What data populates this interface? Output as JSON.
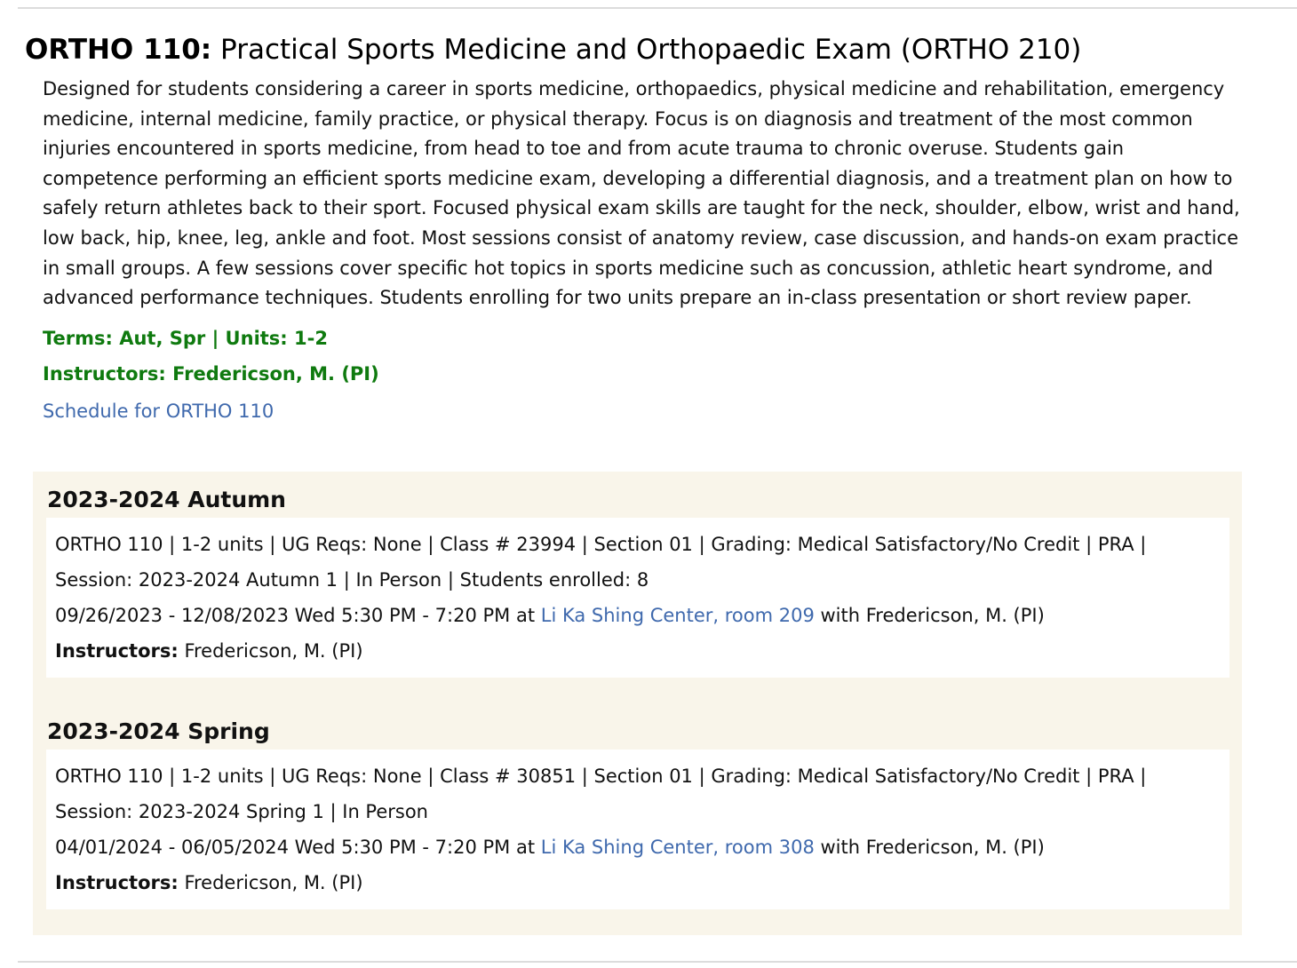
{
  "course": {
    "code": "ORTHO 110:",
    "title": "Practical Sports Medicine and Orthopaedic Exam (ORTHO 210)",
    "description": "Designed for students considering a career in sports medicine, orthopaedics, physical medicine and rehabilitation, emergency medicine, internal medicine, family practice, or physical therapy. Focus is on diagnosis and treatment of the most common injuries encountered in sports medicine, from head to toe and from acute trauma to chronic overuse. Students gain competence performing an efficient sports medicine exam, developing a differential diagnosis, and a treatment plan on how to safely return athletes back to their sport. Focused physical exam skills are taught for the neck, shoulder, elbow, wrist and hand, low back, hip, knee, leg, ankle and foot. Most sessions consist of anatomy review, case discussion, and hands-on exam practice in small groups. A few sessions cover specific hot topics in sports medicine such as concussion, athletic heart syndrome, and advanced performance techniques. Students enrolling for two units prepare an in-class presentation or short review paper.",
    "terms_units": "Terms: Aut, Spr | Units: 1-2",
    "instructors": "Instructors: Fredericson, M. (PI)",
    "schedule_link": "Schedule for ORTHO 110"
  },
  "colors": {
    "meta_green": "#0f7a0f",
    "link_blue": "#3f69ad",
    "panel_bg": "#f9f5ea"
  },
  "terms": [
    {
      "heading": "2023-2024 Autumn",
      "info": "ORTHO 110 | 1-2 units | UG Reqs: None | Class # 23994 | Section 01 | Grading: Medical Satisfactory/No Credit | PRA | Session: 2023-2024 Autumn 1 | In Person | Students enrolled: 8",
      "dates_time": "09/26/2023 - 12/08/2023 Wed 5:30 PM - 7:20 PM at ",
      "location": "Li Ka Shing Center, room 209",
      "with": " with Fredericson, M. (PI)",
      "instructors_label": "Instructors:",
      "instructors": " Fredericson, M. (PI)"
    },
    {
      "heading": "2023-2024 Spring",
      "info": "ORTHO 110 | 1-2 units | UG Reqs: None | Class # 30851 | Section 01 | Grading: Medical Satisfactory/No Credit | PRA | Session: 2023-2024 Spring 1 | In Person",
      "dates_time": "04/01/2024 - 06/05/2024 Wed 5:30 PM - 7:20 PM at ",
      "location": "Li Ka Shing Center, room 308",
      "with": " with Fredericson, M. (PI)",
      "instructors_label": "Instructors:",
      "instructors": " Fredericson, M. (PI)"
    }
  ]
}
